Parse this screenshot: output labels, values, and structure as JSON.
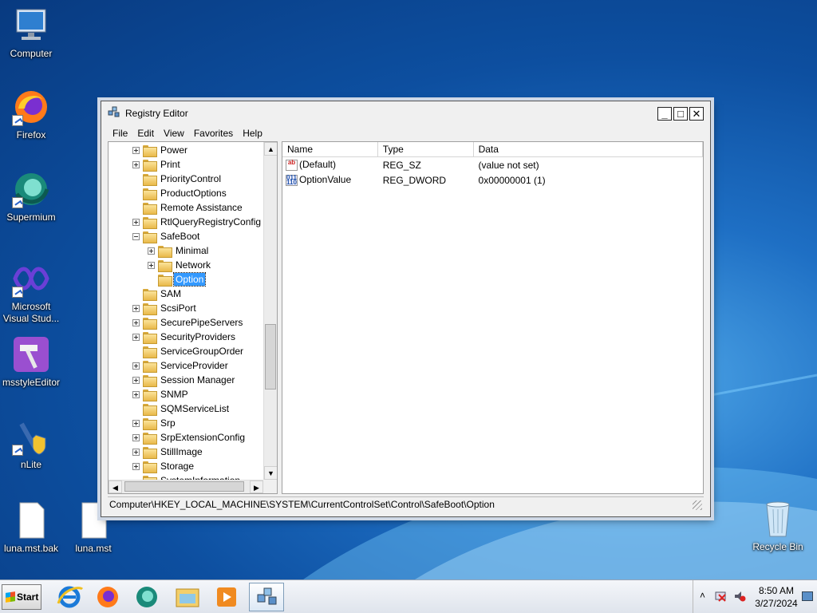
{
  "desktop": {
    "icons": [
      {
        "label": "Computer"
      },
      {
        "label": "Firefox"
      },
      {
        "label": "Supermium"
      },
      {
        "label": "Microsoft Visual Stud..."
      },
      {
        "label": "msstyleEditor"
      },
      {
        "label": "nLite"
      },
      {
        "label": "luna.mst.bak"
      },
      {
        "label": "luna.mst"
      },
      {
        "label": "Recycle Bin"
      }
    ]
  },
  "window": {
    "title": "Registry Editor",
    "controls": {
      "minimize": "_",
      "maximize": "□",
      "close": "✕"
    },
    "menu": [
      "File",
      "Edit",
      "View",
      "Favorites",
      "Help"
    ],
    "tree": [
      {
        "label": "Power",
        "expander": "plus",
        "level": 0
      },
      {
        "label": "Print",
        "expander": "plus",
        "level": 0
      },
      {
        "label": "PriorityControl",
        "expander": "none",
        "level": 0
      },
      {
        "label": "ProductOptions",
        "expander": "none",
        "level": 0
      },
      {
        "label": "Remote Assistance",
        "expander": "none",
        "level": 0
      },
      {
        "label": "RtlQueryRegistryConfig",
        "expander": "plus",
        "level": 0
      },
      {
        "label": "SafeBoot",
        "expander": "minus",
        "level": 0
      },
      {
        "label": "Minimal",
        "expander": "plus",
        "level": 1
      },
      {
        "label": "Network",
        "expander": "plus",
        "level": 1
      },
      {
        "label": "Option",
        "expander": "none",
        "level": 1,
        "selected": true
      },
      {
        "label": "SAM",
        "expander": "none",
        "level": 0
      },
      {
        "label": "ScsiPort",
        "expander": "plus",
        "level": 0
      },
      {
        "label": "SecurePipeServers",
        "expander": "plus",
        "level": 0
      },
      {
        "label": "SecurityProviders",
        "expander": "plus",
        "level": 0
      },
      {
        "label": "ServiceGroupOrder",
        "expander": "none",
        "level": 0
      },
      {
        "label": "ServiceProvider",
        "expander": "plus",
        "level": 0
      },
      {
        "label": "Session Manager",
        "expander": "plus",
        "level": 0
      },
      {
        "label": "SNMP",
        "expander": "plus",
        "level": 0
      },
      {
        "label": "SQMServiceList",
        "expander": "none",
        "level": 0
      },
      {
        "label": "Srp",
        "expander": "plus",
        "level": 0
      },
      {
        "label": "SrpExtensionConfig",
        "expander": "plus",
        "level": 0
      },
      {
        "label": "StillImage",
        "expander": "plus",
        "level": 0
      },
      {
        "label": "Storage",
        "expander": "plus",
        "level": 0
      },
      {
        "label": "SystemInformation",
        "expander": "none",
        "level": 0
      }
    ],
    "list": {
      "columns": [
        "Name",
        "Type",
        "Data"
      ],
      "rows": [
        {
          "icon": "string-value-icon",
          "name": "(Default)",
          "type": "REG_SZ",
          "data": "(value not set)"
        },
        {
          "icon": "binary-value-icon",
          "name": "OptionValue",
          "type": "REG_DWORD",
          "data": "0x00000001 (1)"
        }
      ]
    },
    "status": "Computer\\HKEY_LOCAL_MACHINE\\SYSTEM\\CurrentControlSet\\Control\\SafeBoot\\Option"
  },
  "taskbar": {
    "start_label": "Start",
    "pinned": [
      "internet-explorer-icon",
      "firefox-icon",
      "supermium-icon",
      "file-explorer-icon",
      "media-player-icon",
      "registry-editor-icon"
    ],
    "clock": {
      "time": "8:50 AM",
      "date": "3/27/2024"
    },
    "tray_chevron": "˄"
  }
}
